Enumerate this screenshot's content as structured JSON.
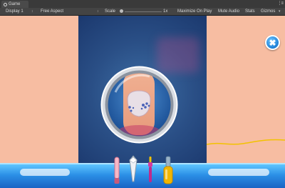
{
  "editor": {
    "tab_label": "Game",
    "window_menu_glyph": "⋮≡",
    "toolbar": {
      "display": "Display 1",
      "aspect": "Free Aspect",
      "scale_label": "Scale",
      "scale_value": "1x",
      "maximize": "Maximize On Play",
      "mute": "Mute Audio",
      "stats": "Stats",
      "gizmos": "Gizmos"
    },
    "dropdown_caret": "↕",
    "gizmos_caret": "▾"
  },
  "game": {
    "close_glyph": "✖",
    "colors": {
      "skin": "#f7bda2",
      "stage_blue": "#2a4f86",
      "tray_blue": "#2b8fe6",
      "accent_yellow": "#f2c200"
    },
    "tools": [
      "nail-file-icon",
      "clipper-icon",
      "brush-icon",
      "polish-bottle-icon"
    ]
  }
}
